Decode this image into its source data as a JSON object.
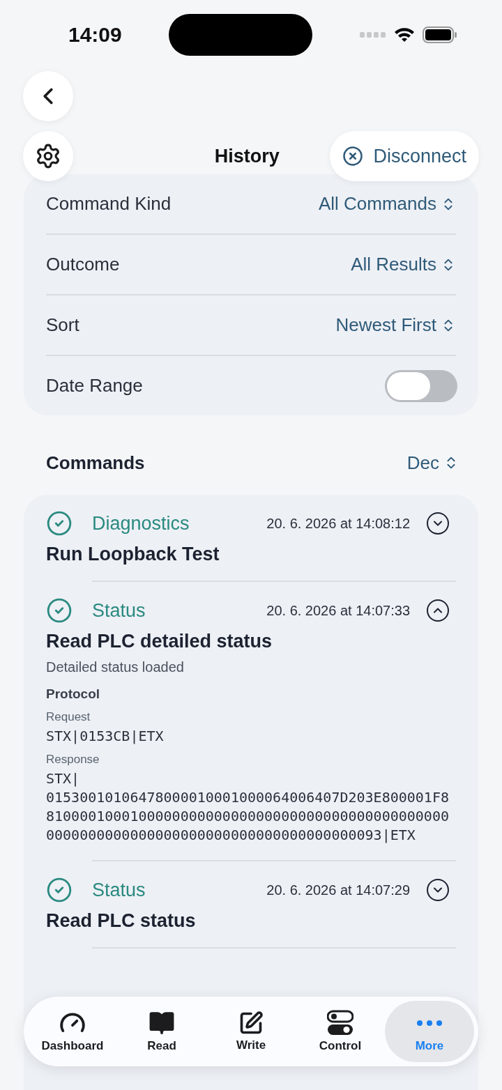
{
  "status_bar": {
    "time": "14:09"
  },
  "nav": {
    "title": "History",
    "disconnect": "Disconnect"
  },
  "filters": [
    {
      "kind": "picker",
      "label": "Command Kind",
      "value": "All Commands"
    },
    {
      "kind": "picker",
      "label": "Outcome",
      "value": "All Results"
    },
    {
      "kind": "picker",
      "label": "Sort",
      "value": "Newest First"
    },
    {
      "kind": "toggle",
      "label": "Date Range",
      "on": false
    }
  ],
  "commands_header": {
    "title": "Commands",
    "order": "Dec"
  },
  "commands": [
    {
      "success": true,
      "category": "Diagnostics",
      "timestamp": "20. 6. 2026 at 14:08:12",
      "title": "Run Loopback Test",
      "expanded": false
    },
    {
      "success": true,
      "category": "Status",
      "timestamp": "20. 6. 2026 at 14:07:33",
      "title": "Read PLC detailed status",
      "expanded": true,
      "subtitle": "Detailed status loaded",
      "protocol": {
        "heading": "Protocol",
        "request_label": "Request",
        "request": "STX|0153CB|ETX",
        "response_label": "Response",
        "response": [
          "STX|",
          "01530010106478000010001000064006407D203E800001F8",
          "810000100010000000000000000000000000000000000000",
          "0000000000000000000000000000000000000093|ETX"
        ]
      }
    },
    {
      "success": true,
      "category": "Status",
      "timestamp": "20. 6. 2026 at 14:07:29",
      "title": "Read PLC status",
      "expanded": false
    }
  ],
  "tabs": [
    {
      "kind": "dashboard",
      "label": "Dashboard",
      "selected": false
    },
    {
      "kind": "read",
      "label": "Read",
      "selected": false
    },
    {
      "kind": "write",
      "label": "Write",
      "selected": false
    },
    {
      "kind": "control",
      "label": "Control",
      "selected": false
    },
    {
      "kind": "more",
      "label": "More",
      "selected": true
    }
  ]
}
